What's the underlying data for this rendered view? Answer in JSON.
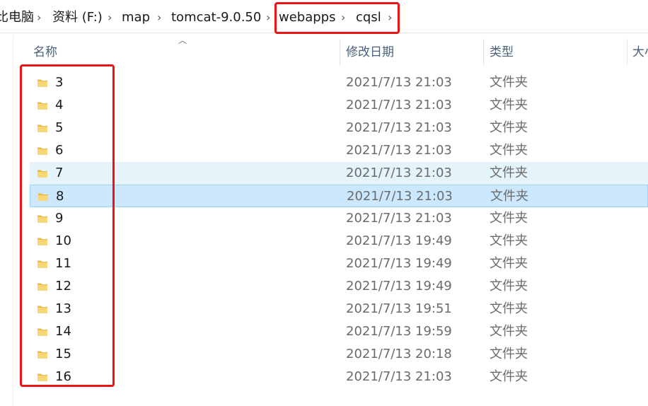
{
  "breadcrumb": [
    {
      "label": "比电脑"
    },
    {
      "label": "资料 (F:)"
    },
    {
      "label": "map"
    },
    {
      "label": "tomcat-9.0.50"
    },
    {
      "label": "webapps"
    },
    {
      "label": "cqsl"
    }
  ],
  "columns": {
    "name": "名称",
    "modified": "修改日期",
    "type": "类型",
    "size": "大小"
  },
  "highlight_color": "#e81416",
  "rows": [
    {
      "name": "3",
      "modified": "2021/7/13 21:03",
      "type": "文件夹",
      "state": "normal"
    },
    {
      "name": "4",
      "modified": "2021/7/13 21:03",
      "type": "文件夹",
      "state": "normal"
    },
    {
      "name": "5",
      "modified": "2021/7/13 21:03",
      "type": "文件夹",
      "state": "normal"
    },
    {
      "name": "6",
      "modified": "2021/7/13 21:03",
      "type": "文件夹",
      "state": "normal"
    },
    {
      "name": "7",
      "modified": "2021/7/13 21:03",
      "type": "文件夹",
      "state": "hover"
    },
    {
      "name": "8",
      "modified": "2021/7/13 21:03",
      "type": "文件夹",
      "state": "selected"
    },
    {
      "name": "9",
      "modified": "2021/7/13 21:03",
      "type": "文件夹",
      "state": "normal"
    },
    {
      "name": "10",
      "modified": "2021/7/13 19:49",
      "type": "文件夹",
      "state": "normal"
    },
    {
      "name": "11",
      "modified": "2021/7/13 19:49",
      "type": "文件夹",
      "state": "normal"
    },
    {
      "name": "12",
      "modified": "2021/7/13 19:49",
      "type": "文件夹",
      "state": "normal"
    },
    {
      "name": "13",
      "modified": "2021/7/13 19:51",
      "type": "文件夹",
      "state": "normal"
    },
    {
      "name": "14",
      "modified": "2021/7/13 19:59",
      "type": "文件夹",
      "state": "normal"
    },
    {
      "name": "15",
      "modified": "2021/7/13 20:18",
      "type": "文件夹",
      "state": "normal"
    },
    {
      "name": "16",
      "modified": "2021/7/13 21:03",
      "type": "文件夹",
      "state": "normal"
    }
  ]
}
